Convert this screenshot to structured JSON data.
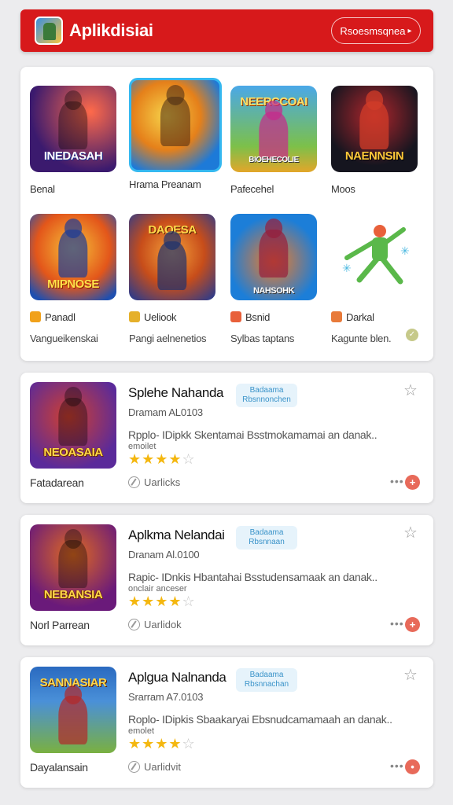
{
  "header": {
    "title": "Aplikdisiai",
    "button_label": "Rsoesmsqnea",
    "button_icon": "chevron-right-icon",
    "accent_color": "#d7191b"
  },
  "featured": {
    "items": [
      {
        "name": "Benal",
        "banner": "INEDASAH",
        "colors": [
          "#3b1a6e",
          "#d23a3a"
        ]
      },
      {
        "name": "Hrama Preanam",
        "banner": "",
        "colors": [
          "#f3b21c",
          "#1d7ad8"
        ]
      },
      {
        "name": "Pafecehel",
        "banner": "NEERCCOAI",
        "banner_bottom": "BIOEHECOLIE",
        "colors": [
          "#2f8fd8",
          "#7cc04a"
        ]
      },
      {
        "name": "Moos",
        "banner": "NAENNSIN",
        "colors": [
          "#15151f",
          "#b0262c"
        ]
      },
      {
        "name": "Panadl",
        "sub": "Vangueikenskai",
        "banner": "MIPNOSE",
        "colors": [
          "#f1a11a",
          "#1e4fb0"
        ]
      },
      {
        "name": "Ueliook",
        "sub": "Pangi aelnenetios",
        "banner": "DAOESA",
        "colors": [
          "#c74d1a",
          "#2d3b8a"
        ]
      },
      {
        "name": "Bsnid",
        "sub": "Sylbas taptans",
        "banner": "NAHSOHK",
        "colors": [
          "#1c7ed8",
          "#f37a24"
        ]
      },
      {
        "name": "Darkal",
        "sub": "Kagunte blen.",
        "banner": "",
        "colors": [
          "#ffffff",
          "#ffffff"
        ]
      }
    ]
  },
  "list": [
    {
      "title": "Splehe Nahanda",
      "tag": "Badaama Rbsnnonchen",
      "meta": "Dramam AL0103",
      "desc": "Rpplo- IDipkk Skentamai Bsstmokamamai an danak..",
      "desc_small": "emoilet",
      "rating": 4,
      "caption": "Fatadarean",
      "action": "Uarlicks",
      "banner": "NEOASAIA",
      "colors": [
        "#5a2a9a",
        "#d04030"
      ]
    },
    {
      "title": "Aplkma Nelandai",
      "tag": "Badaama Rbsnnaan",
      "meta": "Dranam Al.0100",
      "desc": "Rapic- IDnkis Hbantahai Bsstudensamaak an danak..",
      "desc_small": "onclair anceser",
      "rating": 4,
      "caption": "Norl Parrean",
      "action": "Uarlidok",
      "banner": "NEBANSIA",
      "colors": [
        "#6a1a7a",
        "#e06a20"
      ]
    },
    {
      "title": "Aplgua Nalnanda",
      "tag": "Badaama Rbsnnachan",
      "meta": "Srarram A7.0103",
      "desc": "Roplo- IDipkis Sbaakaryai Ebsnudcamamaah an danak..",
      "desc_small": "emolet",
      "rating": 4,
      "caption": "Dayalansain",
      "action": "Uarlidvit",
      "banner": "SANNASIAR",
      "colors": [
        "#2a6ac0",
        "#7ab040"
      ]
    }
  ],
  "icons": {
    "favorite": "star-outline-icon",
    "more": "more-dots-icon",
    "install": "red-circle-icon",
    "verified": "check-badge-icon"
  }
}
